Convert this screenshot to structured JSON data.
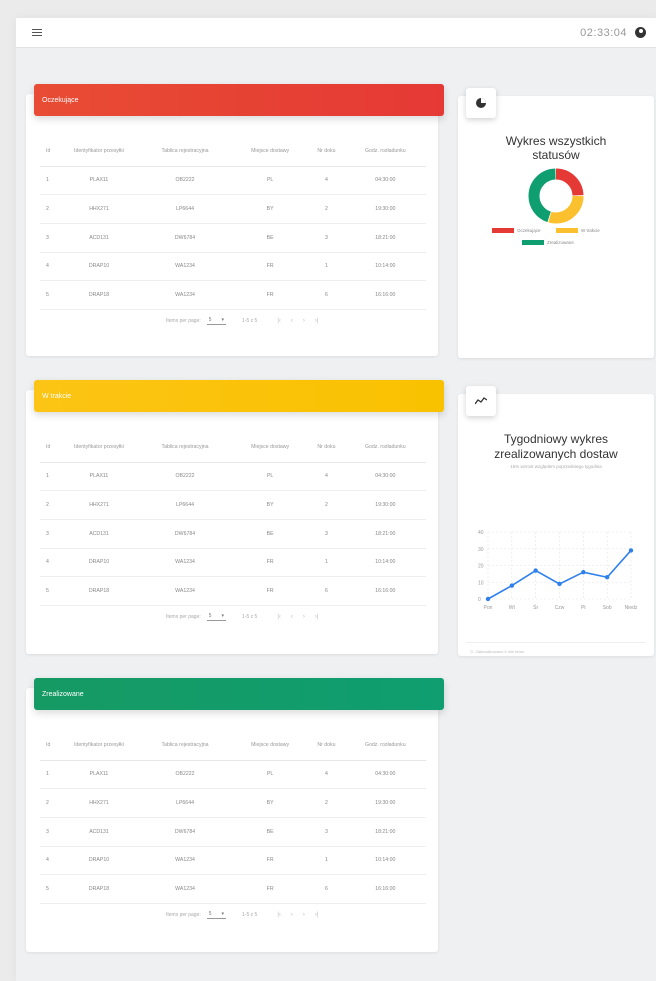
{
  "header": {
    "time": "02:33:04"
  },
  "tables": [
    {
      "title": "Oczekujące",
      "color": "#e53935",
      "columns": [
        "Id",
        "Identyfikator przesyłki",
        "Tablica rejestracyjna",
        "Miejsce dostawy",
        "Nr doku",
        "Godz. rozładunku"
      ],
      "rows": [
        [
          "1",
          "PLAX11",
          "OB2222",
          "PL",
          "4",
          "04:30:00"
        ],
        [
          "2",
          "HHX271",
          "LP6644",
          "BY",
          "2",
          "19:30:00"
        ],
        [
          "3",
          "ACD131",
          "DW6784",
          "BE",
          "3",
          "18:21:00"
        ],
        [
          "4",
          "DRAP10",
          "WA1234",
          "FR",
          "1",
          "10:14:00"
        ],
        [
          "5",
          "DRAP18",
          "WA1234",
          "FR",
          "6",
          "16:16:00"
        ]
      ],
      "pager": {
        "items_label": "Items per page:",
        "items_value": "5",
        "range": "1-5 z 5"
      }
    },
    {
      "title": "W trakcie",
      "color": "#fbc02d",
      "columns": [
        "Id",
        "Identyfikator przesyłki",
        "Tablica rejestracyjna",
        "Miejsce dostawy",
        "Nr doku",
        "Godz. rozładunku"
      ],
      "rows": [
        [
          "1",
          "PLAX11",
          "OB2222",
          "PL",
          "4",
          "04:30:00"
        ],
        [
          "2",
          "HHX271",
          "LP6644",
          "BY",
          "2",
          "19:30:00"
        ],
        [
          "3",
          "ACD131",
          "DW6784",
          "BE",
          "3",
          "18:21:00"
        ],
        [
          "4",
          "DRAP10",
          "WA1234",
          "FR",
          "1",
          "10:14:00"
        ],
        [
          "5",
          "DRAP18",
          "WA1234",
          "FR",
          "6",
          "16:16:00"
        ]
      ],
      "pager": {
        "items_label": "Items per page:",
        "items_value": "5",
        "range": "1-5 z 5"
      }
    },
    {
      "title": "Zrealizowane",
      "color": "#0f9e70",
      "columns": [
        "Id",
        "Identyfikator przesyłki",
        "Tablica rejestracyjna",
        "Miejsce dostawy",
        "Nr doku",
        "Godz. rozładunku"
      ],
      "rows": [
        [
          "1",
          "PLAX11",
          "OB2222",
          "PL",
          "4",
          "04:30:00"
        ],
        [
          "2",
          "HHX271",
          "LP6644",
          "BY",
          "2",
          "19:30:00"
        ],
        [
          "3",
          "ACD131",
          "DW6784",
          "BE",
          "3",
          "18:21:00"
        ],
        [
          "4",
          "DRAP10",
          "WA1234",
          "FR",
          "1",
          "10:14:00"
        ],
        [
          "5",
          "DRAP18",
          "WA1234",
          "FR",
          "6",
          "16:16:00"
        ]
      ],
      "pager": {
        "items_label": "Items per page:",
        "items_value": "5",
        "range": "1-5 z 5"
      }
    }
  ],
  "status_chart": {
    "title": "Wykres wszystkich statusów",
    "legend": [
      {
        "label": "Oczekujące",
        "color": "#e53935"
      },
      {
        "label": "W trakcie",
        "color": "#fbc02d"
      },
      {
        "label": "Zrealizowane",
        "color": "#0f9e70"
      }
    ]
  },
  "weekly_chart": {
    "title_line1": "Tygodniowy wykres",
    "title_line2": "zrealizowanych dostaw",
    "subtitle": "15% wzrost względem poprzedniego tygodnia",
    "footnote": "Zaktualizowano 4 min temu"
  },
  "chart_data": [
    {
      "type": "pie",
      "categories": [
        "Oczekujące",
        "W trakcie",
        "Zrealizowane"
      ],
      "values": [
        25,
        30,
        45
      ],
      "colors": [
        "#e53935",
        "#fbc02d",
        "#0f9e70"
      ],
      "title": "Wykres wszystkich statusów"
    },
    {
      "type": "line",
      "categories": [
        "Pon",
        "Wt",
        "Śr",
        "Czw",
        "Pt",
        "Sob",
        "Niedz"
      ],
      "values": [
        0,
        8,
        17,
        9,
        16,
        13,
        29
      ],
      "ylim": [
        0,
        40
      ],
      "yticks": [
        0,
        10,
        20,
        30,
        40
      ],
      "grid": true,
      "title": "Tygodniowy wykres zrealizowanych dostaw",
      "color": "#2f80ed"
    }
  ]
}
